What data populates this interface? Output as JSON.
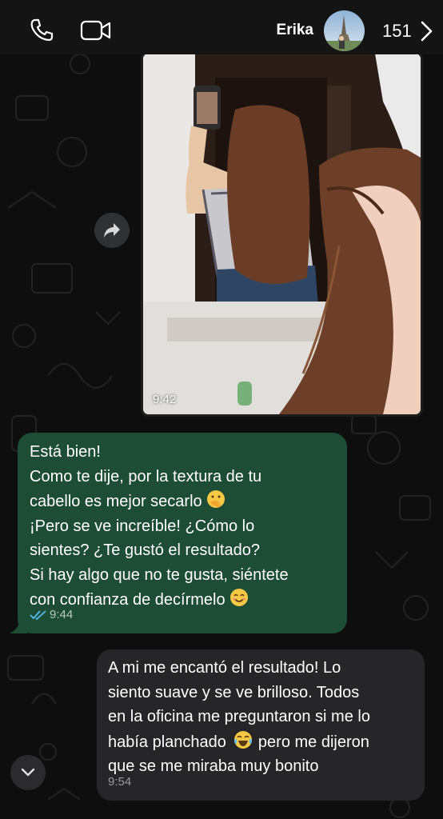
{
  "header": {
    "contact_name": "Erika",
    "unread_count": "151",
    "icons": [
      "phone-icon",
      "video-camera-icon",
      "chevron-right-icon"
    ]
  },
  "messages": [
    {
      "type": "image",
      "direction": "incoming",
      "time": "9:42",
      "image_description": "photo"
    },
    {
      "type": "text",
      "direction": "outgoing",
      "lines": [
        "Está bien!",
        "Como te dije, por la textura de tu",
        "cabello es mejor secarlo",
        "¡Pero se ve increíble! ¿Cómo lo",
        "sientes? ¿Te gustó el resultado?",
        "Si hay algo que no te gusta, siéntete",
        "con confianza de decírmelo"
      ],
      "time": "9:44",
      "status": "read"
    },
    {
      "type": "text",
      "direction": "incoming",
      "lines": [
        "A mi me encantó el resultado! Lo",
        "siento suave y se ve brilloso. Todos",
        "en la oficina me preguntaron si me lo",
        "había planchado",
        "pero me dijeron",
        "que se me miraba muy bonito"
      ],
      "time": "9:54"
    }
  ],
  "colors": {
    "outgoing_bubble": "#1e4d35",
    "incoming_bubble": "#262628",
    "read_ticks": "#53bdeb",
    "background": "#0e0e0e"
  }
}
